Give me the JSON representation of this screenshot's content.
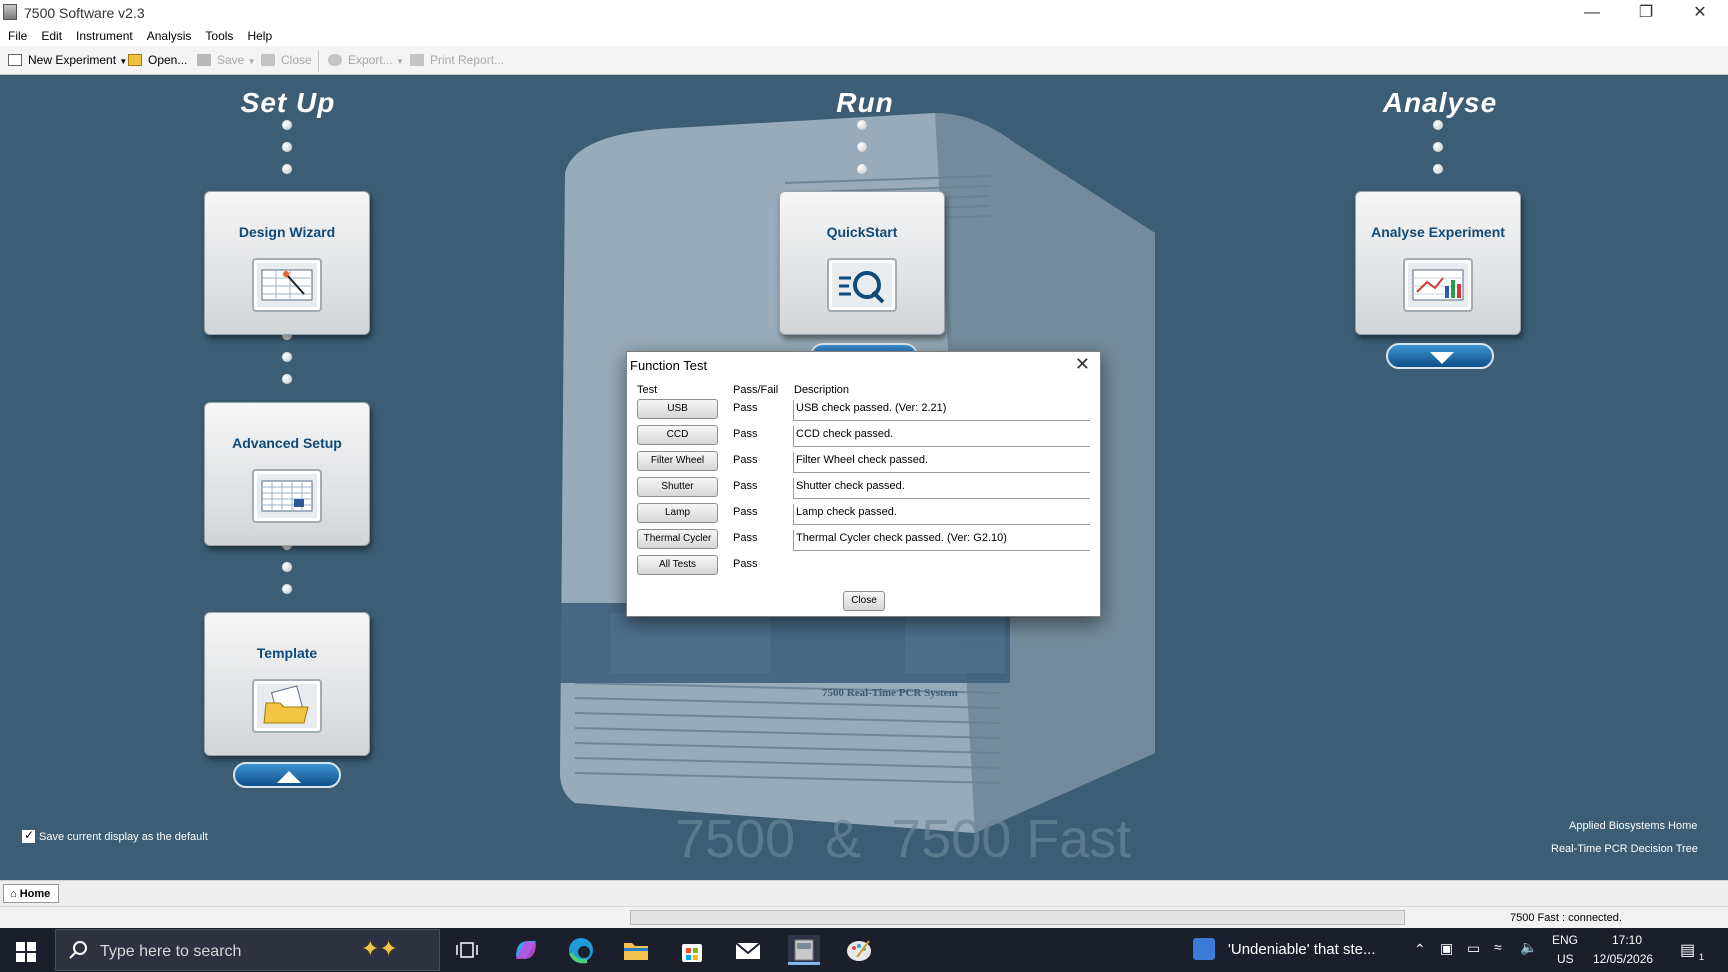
{
  "window": {
    "title": "7500 Software v2.3"
  },
  "menu": [
    "File",
    "Edit",
    "Instrument",
    "Analysis",
    "Tools",
    "Help"
  ],
  "toolbar": {
    "new_experiment": "New Experiment",
    "open": "Open...",
    "save": "Save",
    "close": "Close",
    "export": "Export...",
    "print_report": "Print Report..."
  },
  "home": {
    "setup_title": "Set Up",
    "run_title": "Run",
    "analyse_title": "Analyse",
    "design_wizard": "Design Wizard",
    "advanced_setup": "Advanced Setup",
    "template": "Template",
    "quickstart": "QuickStart",
    "analyse_experiment": "Analyse Experiment",
    "save_default": "Save current display as the default",
    "applied_biosystems_home": "Applied Biosystems Home",
    "decision_tree": "Real-Time PCR Decision Tree",
    "instrument_watermark": "7500  &  7500 Fast",
    "instrument_label": "7500 Real-Time PCR System"
  },
  "dialog": {
    "title": "Function Test",
    "headers": {
      "test": "Test",
      "passfail": "Pass/Fail",
      "description": "Description"
    },
    "rows": [
      {
        "test": "USB",
        "result": "Pass",
        "description": "USB check passed. (Ver: 2.21)"
      },
      {
        "test": "CCD",
        "result": "Pass",
        "description": "CCD check passed."
      },
      {
        "test": "Filter Wheel",
        "result": "Pass",
        "description": "Filter Wheel check passed."
      },
      {
        "test": "Shutter",
        "result": "Pass",
        "description": "Shutter check passed."
      },
      {
        "test": "Lamp",
        "result": "Pass",
        "description": "Lamp check passed."
      },
      {
        "test": "Thermal Cycler",
        "result": "Pass",
        "description": "Thermal Cycler check passed. (Ver: G2.10)"
      },
      {
        "test": "All Tests",
        "result": "Pass",
        "description": ""
      }
    ],
    "close_label": "Close"
  },
  "tabs": {
    "home": "Home"
  },
  "status": {
    "connection": "7500 Fast : connected."
  },
  "taskbar": {
    "search_placeholder": "Type here to search",
    "news": "'Undeniable' that ste...",
    "lang1": "ENG",
    "lang2": "US",
    "time": "17:10",
    "date": "12/05/2026",
    "notif_count": "1"
  },
  "colors": {
    "background": "#3c5d74",
    "card_label": "#0f4a7a",
    "taskbar": "#1b1f2b"
  }
}
